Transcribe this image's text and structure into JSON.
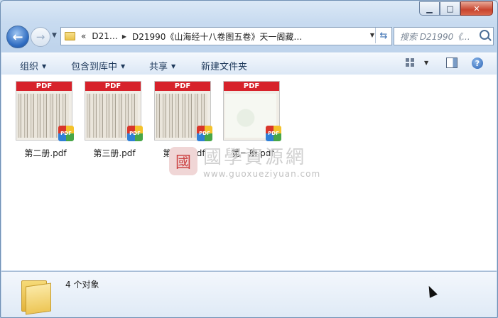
{
  "window": {
    "caption_buttons": {
      "minimize": "▁",
      "maximize": "□",
      "close": "✕"
    }
  },
  "nav": {
    "back_glyph": "←",
    "forward_glyph": "→",
    "breadcrumb_prefix": "«",
    "crumb1": "D21…",
    "crumb2": "D21990《山海经十八卷图五卷》天一阁藏…",
    "search_placeholder": "搜索 D21990《..."
  },
  "toolbar": {
    "organize": "组织",
    "include_library": "包含到库中",
    "share": "共享",
    "new_folder": "新建文件夹",
    "help_glyph": "?"
  },
  "files": [
    {
      "name": "第二册.pdf",
      "header": "PDF",
      "thumb": "scan"
    },
    {
      "name": "第三册.pdf",
      "header": "PDF",
      "thumb": "scan"
    },
    {
      "name": "第四册.pdf",
      "header": "PDF",
      "thumb": "scan"
    },
    {
      "name": "第一册.pdf",
      "header": "PDF",
      "thumb": "light"
    }
  ],
  "pdf_badge": "PDF",
  "watermark": {
    "seal": "國",
    "title": "國學資源網",
    "url": "www.guoxueziyuan.com"
  },
  "details": {
    "count_text": "4 个对象"
  },
  "colors": {
    "pdf_red": "#d7222b",
    "accent": "#2f6cc1"
  }
}
